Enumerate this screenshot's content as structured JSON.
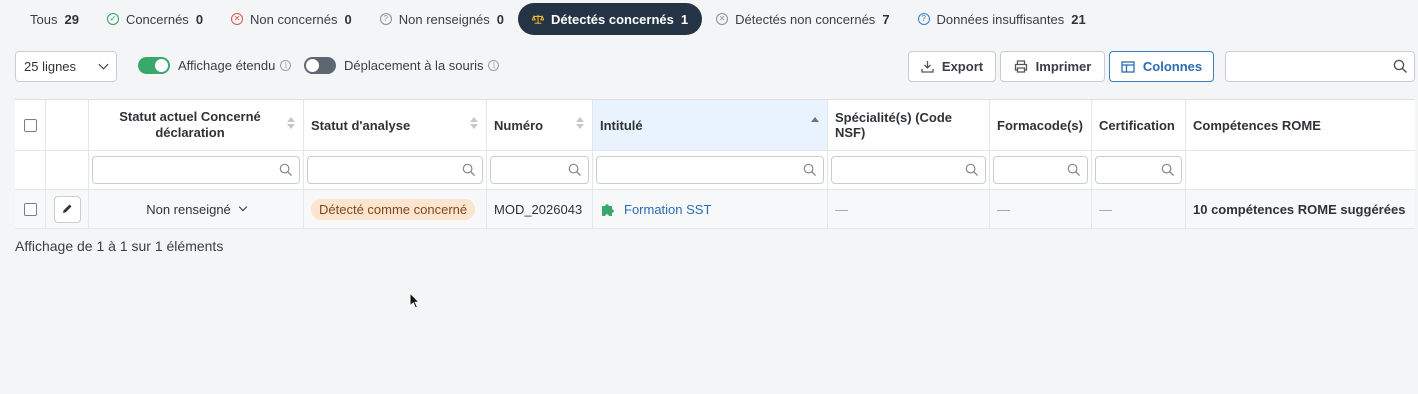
{
  "tabs": [
    {
      "label": "Tous",
      "count": "29",
      "icon": "none"
    },
    {
      "label": "Concernés",
      "count": "0",
      "icon": "check-circle-icon"
    },
    {
      "label": "Non concernés",
      "count": "0",
      "icon": "x-circle-icon"
    },
    {
      "label": "Non renseignés",
      "count": "0",
      "icon": "question-circle-icon"
    },
    {
      "label": "Détectés concernés",
      "count": "1",
      "icon": "scale-icon",
      "active": true
    },
    {
      "label": "Détectés non concernés",
      "count": "7",
      "icon": "x-circle-icon"
    },
    {
      "label": "Données insuffisantes",
      "count": "21",
      "icon": "question-circle-icon"
    }
  ],
  "toolbar": {
    "page_size": "25 lignes",
    "extended_label": "Affichage étendu",
    "mouse_label": "Déplacement à la souris",
    "export_label": "Export",
    "print_label": "Imprimer",
    "columns_label": "Colonnes",
    "search_placeholder": ""
  },
  "table": {
    "headers": {
      "statut_actuel": "Statut actuel Concerné déclaration",
      "statut_analyse": "Statut d'analyse",
      "numero": "Numéro",
      "intitule": "Intitulé",
      "specialites": "Spécialité(s) (Code NSF)",
      "formacode": "Formacode(s)",
      "certification": "Certification",
      "competences": "Compétences ROME"
    },
    "row": {
      "statut_actuel": "Non renseigné",
      "statut_analyse": "Détecté comme concerné",
      "numero": "MOD_2026043",
      "intitule": "Formation SST",
      "specialites": "—",
      "formacode": "—",
      "certification": "—",
      "competences": "10 compétences ROME suggérées"
    }
  },
  "footer": "Affichage de 1 à 1 sur 1 éléments",
  "colors": {
    "active_tab": "#253444",
    "accent_blue": "#2c6cb0",
    "toggle_on": "#3aa86a",
    "badge_bg": "#fde4cf",
    "sorted_header_bg": "#e8f3fd"
  }
}
